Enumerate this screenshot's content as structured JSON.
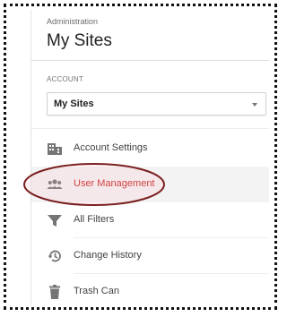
{
  "header": {
    "breadcrumb": "Administration",
    "title": "My Sites"
  },
  "account": {
    "section_label": "ACCOUNT",
    "selected": "My Sites"
  },
  "nav": {
    "items": [
      {
        "label": "Account Settings",
        "icon": "building-icon"
      },
      {
        "label": "User Management",
        "icon": "users-icon",
        "active": true
      },
      {
        "label": "All Filters",
        "icon": "filter-icon"
      },
      {
        "label": "Change History",
        "icon": "history-icon"
      },
      {
        "label": "Trash Can",
        "icon": "trash-icon"
      }
    ]
  },
  "colors": {
    "active_text": "#c62828",
    "annotation_ellipse": "#7a1f1f",
    "icon_gray": "#757575"
  }
}
